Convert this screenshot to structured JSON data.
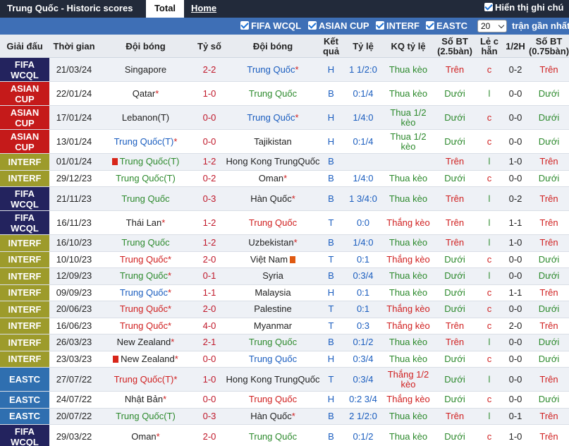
{
  "topbar": {
    "title": "Trung Quốc - Historic scores",
    "tab_total": "Total",
    "tab_home": "Home",
    "show_name": "Hiển thị ghi chú"
  },
  "filters": {
    "items": [
      "FIFA WCQL",
      "ASIAN CUP",
      "INTERF",
      "EASTC"
    ],
    "count": "20",
    "recent_label": "trận gần nhất"
  },
  "columns": [
    "Giải đấu",
    "Thời gian",
    "Đội bóng",
    "Tỷ số",
    "Đội bóng",
    "Kết quả",
    "Tỷ lệ",
    "KQ tỷ lệ",
    "Số BT (2.5bàn)",
    "Lẻ c hẵn",
    "1/2H",
    "Số BT (0.75bàn)"
  ],
  "colors": {
    "fifa": "#23235e",
    "asian": "#c51a1a",
    "interf": "#9d9b2b",
    "eastc": "#2f6fb0"
  },
  "rows": [
    {
      "comp": "FIFA WCQL",
      "ctype": "fifa",
      "date": "21/03/24",
      "home": "Singapore",
      "home_color": "dark",
      "home_star": "",
      "home_flag": "",
      "score": "2-2",
      "away": "Trung Quốc",
      "away_color": "blue",
      "away_star": "*",
      "away_flag": "",
      "result": "H",
      "odds": "1 1/2:0",
      "odds_result": "Thua kèo",
      "or_color": "green",
      "ou": "Trên",
      "ou_color": "red",
      "oe": "c",
      "oe_color": "red",
      "half": "0-2",
      "ou2": "Trên",
      "ou2_color": "red",
      "tall": true
    },
    {
      "comp": "ASIAN CUP",
      "ctype": "asian",
      "date": "22/01/24",
      "home": "Qatar",
      "home_color": "dark",
      "home_star": "*",
      "home_flag": "",
      "score": "1-0",
      "away": "Trung Quốc",
      "away_color": "green",
      "away_star": "",
      "away_flag": "",
      "result": "B",
      "odds": "0:1/4",
      "odds_result": "Thua kèo",
      "or_color": "green",
      "ou": "Dưới",
      "ou_color": "green",
      "oe": "l",
      "oe_color": "green",
      "half": "0-0",
      "ou2": "Dưới",
      "ou2_color": "green",
      "tall": true
    },
    {
      "comp": "ASIAN CUP",
      "ctype": "asian",
      "date": "17/01/24",
      "home": "Lebanon(T)",
      "home_color": "dark",
      "home_star": "",
      "home_flag": "",
      "score": "0-0",
      "away": "Trung Quốc",
      "away_color": "blue",
      "away_star": "*",
      "away_flag": "",
      "result": "H",
      "odds": "1/4:0",
      "odds_result": "Thua 1/2 kèo",
      "or_color": "green",
      "ou": "Dưới",
      "ou_color": "green",
      "oe": "c",
      "oe_color": "red",
      "half": "0-0",
      "ou2": "Dưới",
      "ou2_color": "green",
      "tall": true
    },
    {
      "comp": "ASIAN CUP",
      "ctype": "asian",
      "date": "13/01/24",
      "home": "Trung Quốc(T)",
      "home_color": "blue",
      "home_star": "*",
      "home_flag": "",
      "score": "0-0",
      "away": "Tajikistan",
      "away_color": "dark",
      "away_star": "",
      "away_flag": "",
      "result": "H",
      "odds": "0:1/4",
      "odds_result": "Thua 1/2 kèo",
      "or_color": "green",
      "ou": "Dưới",
      "ou_color": "green",
      "oe": "c",
      "oe_color": "red",
      "half": "0-0",
      "ou2": "Dưới",
      "ou2_color": "green",
      "tall": true
    },
    {
      "comp": "INTERF",
      "ctype": "interf",
      "date": "01/01/24",
      "home": "Trung Quốc(T)",
      "home_color": "green",
      "home_star": "",
      "home_flag": "3",
      "score": "1-2",
      "away": "Hong Kong TrungQuốc",
      "away_color": "dark",
      "away_star": "",
      "away_flag": "",
      "result": "B",
      "odds": "",
      "odds_result": "",
      "or_color": "green",
      "ou": "Trên",
      "ou_color": "red",
      "oe": "l",
      "oe_color": "green",
      "half": "1-0",
      "ou2": "Trên",
      "ou2_color": "red",
      "tall": false
    },
    {
      "comp": "INTERF",
      "ctype": "interf",
      "date": "29/12/23",
      "home": "Trung Quốc(T)",
      "home_color": "green",
      "home_star": "",
      "home_flag": "",
      "score": "0-2",
      "away": "Oman",
      "away_color": "dark",
      "away_star": "*",
      "away_flag": "",
      "result": "B",
      "odds": "1/4:0",
      "odds_result": "Thua kèo",
      "or_color": "green",
      "ou": "Dưới",
      "ou_color": "green",
      "oe": "c",
      "oe_color": "red",
      "half": "0-0",
      "ou2": "Dưới",
      "ou2_color": "green",
      "tall": false
    },
    {
      "comp": "FIFA WCQL",
      "ctype": "fifa",
      "date": "21/11/23",
      "home": "Trung Quốc",
      "home_color": "green",
      "home_star": "",
      "home_flag": "",
      "score": "0-3",
      "away": "Hàn Quốc",
      "away_color": "dark",
      "away_star": "*",
      "away_flag": "",
      "result": "B",
      "odds": "1 3/4:0",
      "odds_result": "Thua kèo",
      "or_color": "green",
      "ou": "Trên",
      "ou_color": "red",
      "oe": "l",
      "oe_color": "green",
      "half": "0-2",
      "ou2": "Trên",
      "ou2_color": "red",
      "tall": true
    },
    {
      "comp": "FIFA WCQL",
      "ctype": "fifa",
      "date": "16/11/23",
      "home": "Thái Lan",
      "home_color": "dark",
      "home_star": "*",
      "home_flag": "",
      "score": "1-2",
      "away": "Trung Quốc",
      "away_color": "red",
      "away_star": "",
      "away_flag": "",
      "result": "T",
      "odds": "0:0",
      "odds_result": "Thắng kèo",
      "or_color": "red",
      "ou": "Trên",
      "ou_color": "red",
      "oe": "l",
      "oe_color": "green",
      "half": "1-1",
      "ou2": "Trên",
      "ou2_color": "red",
      "tall": true
    },
    {
      "comp": "INTERF",
      "ctype": "interf",
      "date": "16/10/23",
      "home": "Trung Quốc",
      "home_color": "green",
      "home_star": "",
      "home_flag": "",
      "score": "1-2",
      "away": "Uzbekistan",
      "away_color": "dark",
      "away_star": "*",
      "away_flag": "",
      "result": "B",
      "odds": "1/4:0",
      "odds_result": "Thua kèo",
      "or_color": "green",
      "ou": "Trên",
      "ou_color": "red",
      "oe": "l",
      "oe_color": "green",
      "half": "1-0",
      "ou2": "Trên",
      "ou2_color": "red",
      "tall": false
    },
    {
      "comp": "INTERF",
      "ctype": "interf",
      "date": "10/10/23",
      "home": "Trung Quốc",
      "home_color": "red",
      "home_star": "*",
      "home_flag": "",
      "score": "2-0",
      "away": "Việt Nam",
      "away_color": "dark",
      "away_star": "",
      "away_flag": "r",
      "result": "T",
      "odds": "0:1",
      "odds_result": "Thắng kèo",
      "or_color": "red",
      "ou": "Dưới",
      "ou_color": "green",
      "oe": "c",
      "oe_color": "red",
      "half": "0-0",
      "ou2": "Dưới",
      "ou2_color": "green",
      "tall": false
    },
    {
      "comp": "INTERF",
      "ctype": "interf",
      "date": "12/09/23",
      "home": "Trung Quốc",
      "home_color": "green",
      "home_star": "*",
      "home_flag": "",
      "score": "0-1",
      "away": "Syria",
      "away_color": "dark",
      "away_star": "",
      "away_flag": "",
      "result": "B",
      "odds": "0:3/4",
      "odds_result": "Thua kèo",
      "or_color": "green",
      "ou": "Dưới",
      "ou_color": "green",
      "oe": "l",
      "oe_color": "green",
      "half": "0-0",
      "ou2": "Dưới",
      "ou2_color": "green",
      "tall": false
    },
    {
      "comp": "INTERF",
      "ctype": "interf",
      "date": "09/09/23",
      "home": "Trung Quốc",
      "home_color": "blue",
      "home_star": "*",
      "home_flag": "",
      "score": "1-1",
      "away": "Malaysia",
      "away_color": "dark",
      "away_star": "",
      "away_flag": "",
      "result": "H",
      "odds": "0:1",
      "odds_result": "Thua kèo",
      "or_color": "green",
      "ou": "Dưới",
      "ou_color": "green",
      "oe": "c",
      "oe_color": "red",
      "half": "1-1",
      "ou2": "Trên",
      "ou2_color": "red",
      "tall": false
    },
    {
      "comp": "INTERF",
      "ctype": "interf",
      "date": "20/06/23",
      "home": "Trung Quốc",
      "home_color": "red",
      "home_star": "*",
      "home_flag": "",
      "score": "2-0",
      "away": "Palestine",
      "away_color": "dark",
      "away_star": "",
      "away_flag": "",
      "result": "T",
      "odds": "0:1",
      "odds_result": "Thắng kèo",
      "or_color": "red",
      "ou": "Dưới",
      "ou_color": "green",
      "oe": "c",
      "oe_color": "red",
      "half": "0-0",
      "ou2": "Dưới",
      "ou2_color": "green",
      "tall": false
    },
    {
      "comp": "INTERF",
      "ctype": "interf",
      "date": "16/06/23",
      "home": "Trung Quốc",
      "home_color": "red",
      "home_star": "*",
      "home_flag": "",
      "score": "4-0",
      "away": "Myanmar",
      "away_color": "dark",
      "away_star": "",
      "away_flag": "",
      "result": "T",
      "odds": "0:3",
      "odds_result": "Thắng kèo",
      "or_color": "red",
      "ou": "Trên",
      "ou_color": "red",
      "oe": "c",
      "oe_color": "red",
      "half": "2-0",
      "ou2": "Trên",
      "ou2_color": "red",
      "tall": false
    },
    {
      "comp": "INTERF",
      "ctype": "interf",
      "date": "26/03/23",
      "home": "New Zealand",
      "home_color": "dark",
      "home_star": "*",
      "home_flag": "",
      "score": "2-1",
      "away": "Trung Quốc",
      "away_color": "green",
      "away_star": "",
      "away_flag": "",
      "result": "B",
      "odds": "0:1/2",
      "odds_result": "Thua kèo",
      "or_color": "green",
      "ou": "Trên",
      "ou_color": "red",
      "oe": "l",
      "oe_color": "green",
      "half": "0-0",
      "ou2": "Dưới",
      "ou2_color": "green",
      "tall": false
    },
    {
      "comp": "INTERF",
      "ctype": "interf",
      "date": "23/03/23",
      "home": "New Zealand",
      "home_color": "dark",
      "home_star": "*",
      "home_flag": "1",
      "score": "0-0",
      "away": "Trung Quốc",
      "away_color": "blue",
      "away_star": "",
      "away_flag": "",
      "result": "H",
      "odds": "0:3/4",
      "odds_result": "Thua kèo",
      "or_color": "green",
      "ou": "Dưới",
      "ou_color": "green",
      "oe": "c",
      "oe_color": "red",
      "half": "0-0",
      "ou2": "Dưới",
      "ou2_color": "green",
      "tall": false
    },
    {
      "comp": "EASTC",
      "ctype": "eastc",
      "date": "27/07/22",
      "home": "Trung Quốc(T)",
      "home_color": "red",
      "home_star": "*",
      "home_flag": "",
      "score": "1-0",
      "away": "Hong Kong TrungQuốc",
      "away_color": "dark",
      "away_star": "",
      "away_flag": "",
      "result": "T",
      "odds": "0:3/4",
      "odds_result": "Thắng 1/2 kèo",
      "or_color": "red",
      "ou": "Dưới",
      "ou_color": "green",
      "oe": "l",
      "oe_color": "green",
      "half": "0-0",
      "ou2": "Trên",
      "ou2_color": "red",
      "tall": true
    },
    {
      "comp": "EASTC",
      "ctype": "eastc",
      "date": "24/07/22",
      "home": "Nhật Bản",
      "home_color": "dark",
      "home_star": "*",
      "home_flag": "",
      "score": "0-0",
      "away": "Trung Quốc",
      "away_color": "red",
      "away_star": "",
      "away_flag": "",
      "result": "H",
      "odds": "0:2 3/4",
      "odds_result": "Thắng kèo",
      "or_color": "red",
      "ou": "Dưới",
      "ou_color": "green",
      "oe": "c",
      "oe_color": "red",
      "half": "0-0",
      "ou2": "Dưới",
      "ou2_color": "green",
      "tall": false
    },
    {
      "comp": "EASTC",
      "ctype": "eastc",
      "date": "20/07/22",
      "home": "Trung Quốc(T)",
      "home_color": "green",
      "home_star": "",
      "home_flag": "",
      "score": "0-3",
      "away": "Hàn Quốc",
      "away_color": "dark",
      "away_star": "*",
      "away_flag": "",
      "result": "B",
      "odds": "2 1/2:0",
      "odds_result": "Thua kèo",
      "or_color": "green",
      "ou": "Trên",
      "ou_color": "red",
      "oe": "l",
      "oe_color": "green",
      "half": "0-1",
      "ou2": "Trên",
      "ou2_color": "red",
      "tall": false
    },
    {
      "comp": "FIFA WCQL",
      "ctype": "fifa",
      "date": "29/03/22",
      "home": "Oman",
      "home_color": "dark",
      "home_star": "*",
      "home_flag": "",
      "score": "2-0",
      "away": "Trung Quốc",
      "away_color": "green",
      "away_star": "",
      "away_flag": "",
      "result": "B",
      "odds": "0:1/2",
      "odds_result": "Thua kèo",
      "or_color": "green",
      "ou": "Dưới",
      "ou_color": "green",
      "oe": "c",
      "oe_color": "red",
      "half": "1-0",
      "ou2": "Trên",
      "ou2_color": "red",
      "tall": true
    }
  ]
}
